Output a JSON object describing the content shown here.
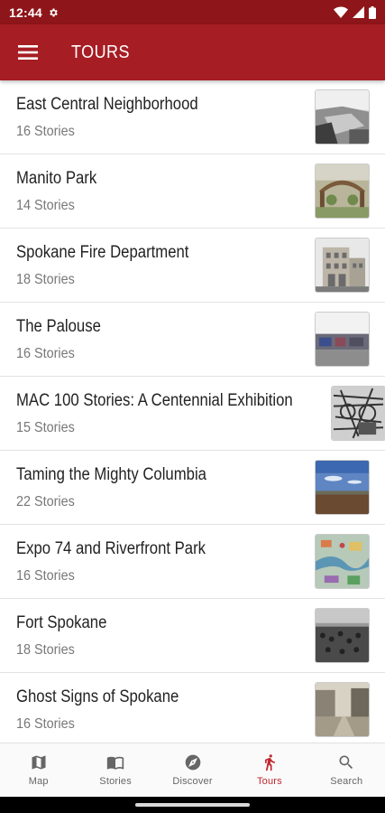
{
  "status_bar": {
    "time": "12:44"
  },
  "app_bar": {
    "title": "TOURS"
  },
  "tours": [
    {
      "title": "East Central Neighborhood",
      "count": "16 Stories"
    },
    {
      "title": "Manito Park",
      "count": "14 Stories"
    },
    {
      "title": "Spokane Fire Department",
      "count": "18 Stories"
    },
    {
      "title": "The Palouse",
      "count": "16 Stories"
    },
    {
      "title": "MAC 100 Stories: A Centennial Exhibition",
      "count": "15 Stories"
    },
    {
      "title": "Taming the Mighty Columbia",
      "count": "22 Stories"
    },
    {
      "title": "Expo 74 and Riverfront Park",
      "count": "16 Stories"
    },
    {
      "title": "Fort Spokane",
      "count": "18 Stories"
    },
    {
      "title": "Ghost Signs of Spokane",
      "count": "16 Stories"
    }
  ],
  "bottom_nav": {
    "items": [
      {
        "label": "Map",
        "icon": "map-icon"
      },
      {
        "label": "Stories",
        "icon": "book-icon"
      },
      {
        "label": "Discover",
        "icon": "compass-icon"
      },
      {
        "label": "Tours",
        "icon": "walking-icon"
      },
      {
        "label": "Search",
        "icon": "search-icon"
      }
    ],
    "active": "Tours"
  },
  "colors": {
    "status_bar": "#8e1519",
    "app_bar": "#a61d23",
    "accent": "#c0272d"
  }
}
